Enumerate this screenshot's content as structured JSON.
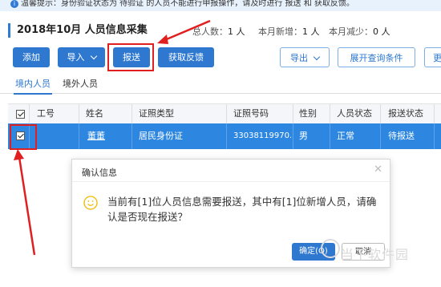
{
  "tip": {
    "text": "温馨提示：身份验证状态为 待验证 的人员不能进行申报操作，请及时进行 报送 和 获取反馈。",
    "icon": "info-icon"
  },
  "header": {
    "title": "2018年10月  人员信息采集",
    "total_label": "总人数：",
    "total_value": "1 人",
    "new_label": "本月新增：",
    "new_value": "1 人",
    "reduce_label": "本月减少：",
    "reduce_value": "0 人"
  },
  "toolbar": {
    "add": "添加",
    "import": "导入",
    "submit": "报送",
    "feedback": "获取反馈",
    "export": "导出",
    "expand": "展开查询条件",
    "more": "更"
  },
  "tabs": [
    {
      "label": "境内人员"
    },
    {
      "label": "境外人员"
    }
  ],
  "table": {
    "columns": [
      "工号",
      "姓名",
      "证照类型",
      "证照号码",
      "性别",
      "人员状态",
      "报送状态"
    ],
    "rows": [
      {
        "id": "",
        "name": "董董",
        "doc_type": "居民身份证",
        "doc_no": "33038119970...",
        "gender": "男",
        "status": "正常",
        "report": "待报送"
      }
    ]
  },
  "dialog": {
    "title": "确认信息",
    "message": "当前有[1]位人员信息需要报送，其中有[1]位新增人员，请确认是否现在报送？",
    "ok": "确定(O)",
    "cancel": "取消"
  },
  "watermark": "当下软件园",
  "colors": {
    "primary": "#2e78d0",
    "row_selected": "#2d87e1",
    "annotation_red": "#e02020"
  }
}
